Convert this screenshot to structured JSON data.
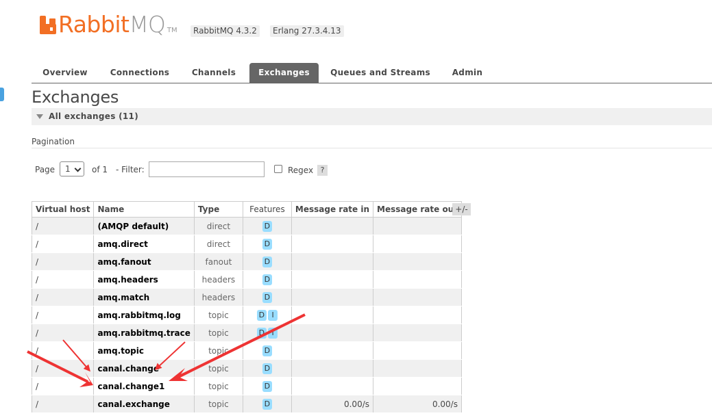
{
  "header": {
    "logo_rabbit": "Rabbit",
    "logo_mq": "MQ",
    "logo_tm": "TM",
    "rabbitmq_version": "RabbitMQ 4.3.2",
    "erlang_version": "Erlang 27.3.4.13"
  },
  "tabs": [
    {
      "label": "Overview",
      "active": false
    },
    {
      "label": "Connections",
      "active": false
    },
    {
      "label": "Channels",
      "active": false
    },
    {
      "label": "Exchanges",
      "active": true
    },
    {
      "label": "Queues and Streams",
      "active": false
    },
    {
      "label": "Admin",
      "active": false
    }
  ],
  "page": {
    "title": "Exchanges",
    "section_title": "All exchanges (11)",
    "pagination_label": "Pagination",
    "page_label": "Page",
    "page_value": "1",
    "of_label": "of 1",
    "filter_label": "- Filter:",
    "filter_value": "",
    "regex_label": "Regex",
    "help_label": "?",
    "plus_minus": "+/-"
  },
  "table": {
    "headers": [
      "Virtual host",
      "Name",
      "Type",
      "Features",
      "Message rate in",
      "Message rate out"
    ],
    "rows": [
      {
        "vhost": "/",
        "name": "(AMQP default)",
        "type": "direct",
        "features": [
          "D"
        ],
        "rate_in": "",
        "rate_out": ""
      },
      {
        "vhost": "/",
        "name": "amq.direct",
        "type": "direct",
        "features": [
          "D"
        ],
        "rate_in": "",
        "rate_out": ""
      },
      {
        "vhost": "/",
        "name": "amq.fanout",
        "type": "fanout",
        "features": [
          "D"
        ],
        "rate_in": "",
        "rate_out": ""
      },
      {
        "vhost": "/",
        "name": "amq.headers",
        "type": "headers",
        "features": [
          "D"
        ],
        "rate_in": "",
        "rate_out": ""
      },
      {
        "vhost": "/",
        "name": "amq.match",
        "type": "headers",
        "features": [
          "D"
        ],
        "rate_in": "",
        "rate_out": ""
      },
      {
        "vhost": "/",
        "name": "amq.rabbitmq.log",
        "type": "topic",
        "features": [
          "D",
          "I"
        ],
        "rate_in": "",
        "rate_out": ""
      },
      {
        "vhost": "/",
        "name": "amq.rabbitmq.trace",
        "type": "topic",
        "features": [
          "D",
          "I"
        ],
        "rate_in": "",
        "rate_out": ""
      },
      {
        "vhost": "/",
        "name": "amq.topic",
        "type": "topic",
        "features": [
          "D"
        ],
        "rate_in": "",
        "rate_out": ""
      },
      {
        "vhost": "/",
        "name": "canal.change",
        "type": "topic",
        "features": [
          "D"
        ],
        "rate_in": "",
        "rate_out": ""
      },
      {
        "vhost": "/",
        "name": "canal.change1",
        "type": "topic",
        "features": [
          "D"
        ],
        "rate_in": "",
        "rate_out": ""
      },
      {
        "vhost": "/",
        "name": "canal.exchange",
        "type": "topic",
        "features": [
          "D"
        ],
        "rate_in": "0.00/s",
        "rate_out": "0.00/s"
      }
    ]
  },
  "colors": {
    "brand_orange": "#f26f24",
    "active_tab": "#666666",
    "feature_badge": "#99ddff",
    "annotation_arrow": "#ee3333"
  }
}
